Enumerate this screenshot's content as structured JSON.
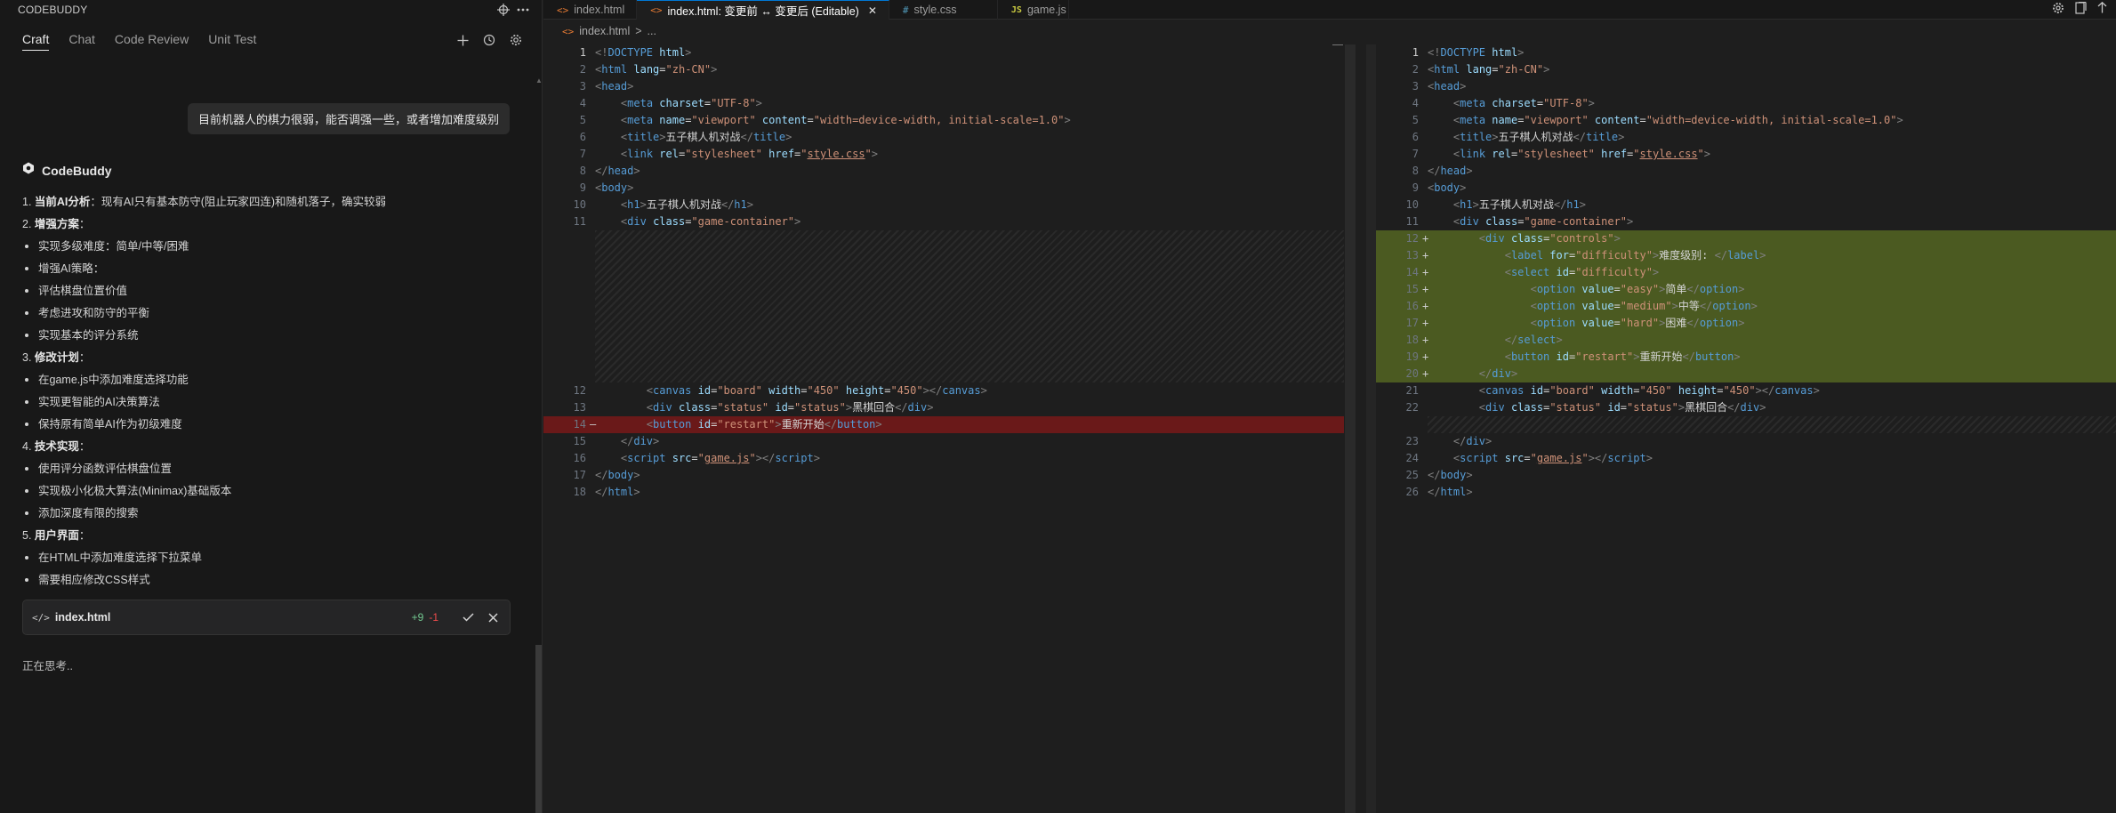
{
  "sidebar": {
    "title": "CODEBUDDY",
    "tabs": [
      {
        "label": "Craft",
        "active": true
      },
      {
        "label": "Chat",
        "active": false
      },
      {
        "label": "Code Review",
        "active": false
      },
      {
        "label": "Unit Test",
        "active": false
      }
    ],
    "user_message": "目前机器人的棋力很弱，能否调强一些，或者增加难度级别",
    "assistant_name": "CodeBuddy",
    "response_lines": [
      {
        "kind": "numbered",
        "prefix": "1. ",
        "title": "当前AI分析",
        "text": "：现有AI只有基本防守(阻止玩家四连)和随机落子，确实较弱"
      },
      {
        "kind": "numbered",
        "prefix": "2. ",
        "title": "增强方案",
        "text": "："
      },
      {
        "kind": "bullet",
        "text": "实现多级难度：简单/中等/困难"
      },
      {
        "kind": "bullet",
        "text": "增强AI策略："
      },
      {
        "kind": "bullet",
        "text": "评估棋盘位置价值"
      },
      {
        "kind": "bullet",
        "text": "考虑进攻和防守的平衡"
      },
      {
        "kind": "bullet",
        "text": "实现基本的评分系统"
      },
      {
        "kind": "numbered",
        "prefix": "3. ",
        "title": "修改计划",
        "text": "："
      },
      {
        "kind": "bullet",
        "text": "在game.js中添加难度选择功能"
      },
      {
        "kind": "bullet",
        "text": "实现更智能的AI决策算法"
      },
      {
        "kind": "bullet",
        "text": "保持原有简单AI作为初级难度"
      },
      {
        "kind": "numbered",
        "prefix": "4. ",
        "title": "技术实现",
        "text": "："
      },
      {
        "kind": "bullet",
        "text": "使用评分函数评估棋盘位置"
      },
      {
        "kind": "bullet",
        "text": "实现极小化极大算法(Minimax)基础版本"
      },
      {
        "kind": "bullet",
        "text": "添加深度有限的搜索"
      },
      {
        "kind": "numbered",
        "prefix": "5. ",
        "title": "用户界面",
        "text": "："
      },
      {
        "kind": "bullet",
        "text": "在HTML中添加难度选择下拉菜单"
      },
      {
        "kind": "bullet",
        "text": "需要相应修改CSS样式"
      }
    ],
    "file_card": {
      "name": "index.html",
      "added": "+9",
      "removed": "-1"
    },
    "status_text": "正在思考..",
    "colors": {
      "added": "#73c991",
      "removed": "#f14c4c"
    }
  },
  "editor": {
    "tabs": [
      {
        "label": "index.html",
        "icon": "<>",
        "type": "html",
        "active": false
      },
      {
        "label": "index.html: 变更前 ↔ 变更后 (Editable)",
        "icon": "<>",
        "type": "html",
        "active": true
      },
      {
        "label": "style.css",
        "icon": "#",
        "type": "css",
        "active": false
      },
      {
        "label": "game.js",
        "icon": "JS",
        "type": "js",
        "active": false
      }
    ],
    "breadcrumb": {
      "file": "index.html",
      "sep": ">",
      "rest": "..."
    },
    "colors": {
      "deleted_line": "#6a1919",
      "inserted_line": "#4b5a21",
      "tag": "#569cd6",
      "attr": "#9cdcfe",
      "string": "#ce9178"
    }
  }
}
